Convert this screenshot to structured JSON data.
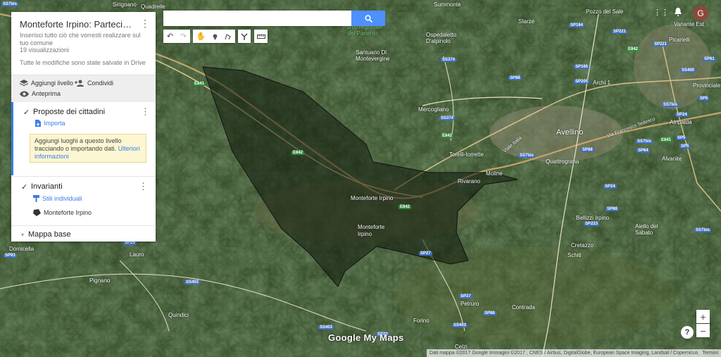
{
  "map_title": "Monteforte Irpino: Partecipa al P...",
  "description": "Inserisci tutto ciò che vorresti realizzare sul tuo comune",
  "views": "19 visualizzazioni",
  "saved_status": "Tutte le modifiche sono state salvate in Drive",
  "actions": {
    "add_layer": "Aggiungi livello",
    "share": "Condividi",
    "preview": "Anteprima"
  },
  "layers": [
    {
      "name": "Proposte dei cittadini",
      "import": "Importa",
      "hint": "Aggiungi luoghi a questo livello tracciando o importando dati.",
      "hint_link": "Ulteriori informazioni"
    },
    {
      "name": "Invarianti",
      "style": "Stili individuali",
      "place": "Monteforte Irpino"
    }
  ],
  "basemap": "Mappa base",
  "search": {
    "placeholder": ""
  },
  "brand": "Google My Maps",
  "attribution": "Dati mappa ©2017 Google Immagini ©2017 , CNES / Airbus, DigitalGlobe, European Space Imaging, Landsat / Copernicus",
  "terms": "Termini",
  "user_initial": "G",
  "map_labels": [
    {
      "text": "Avellino",
      "cls": "city"
    },
    {
      "text": "Monteforte Irpino",
      "cls": "town"
    },
    {
      "text": "Monteforte\nIrpino",
      "cls": "town2"
    },
    {
      "text": "Parco regionale del Partenio",
      "cls": "park"
    },
    {
      "text": "Santuario Di Montevergine",
      "cls": "sanct"
    },
    {
      "text": "Ospedaletto D'alpinolo",
      "cls": "osp"
    },
    {
      "text": "Summonte",
      "cls": "summ"
    },
    {
      "text": "Pozzo del Sale",
      "cls": "pozzo"
    },
    {
      "text": "Starze",
      "cls": "starze"
    },
    {
      "text": "Mercogliano",
      "cls": "merc"
    },
    {
      "text": "Torelli-torrette",
      "cls": "torelli"
    },
    {
      "text": "Moline",
      "cls": "moline"
    },
    {
      "text": "Rivarano",
      "cls": "rivarano"
    },
    {
      "text": "Quattrograna",
      "cls": "quattro"
    },
    {
      "text": "Atripalda",
      "cls": "atri"
    },
    {
      "text": "Alvanite",
      "cls": "alva"
    },
    {
      "text": "Bellizzi Irpino",
      "cls": "belli"
    },
    {
      "text": "Aiello del Sabato",
      "cls": "aiello"
    },
    {
      "text": "Cretazzo",
      "cls": "creta"
    },
    {
      "text": "Schiti",
      "cls": "schiti"
    },
    {
      "text": "Contrada",
      "cls": "contrada"
    },
    {
      "text": "Forino",
      "cls": "forino"
    },
    {
      "text": "Petruro",
      "cls": "petruro"
    },
    {
      "text": "Quindici",
      "cls": "quindici"
    },
    {
      "text": "Pignano",
      "cls": "pignano"
    },
    {
      "text": "Lauro",
      "cls": "lauro"
    },
    {
      "text": "Domicella",
      "cls": "domi"
    },
    {
      "text": "Sirignano",
      "cls": "siri"
    },
    {
      "text": "Quadrelle",
      "cls": "quad"
    },
    {
      "text": "Picarielli",
      "cls": "pica"
    },
    {
      "text": "Variante Est",
      "cls": "variante"
    },
    {
      "text": "Provinciale",
      "cls": "prov"
    },
    {
      "text": "Archi 1",
      "cls": "archi"
    },
    {
      "text": "Celzi",
      "cls": "celzi"
    },
    {
      "text": "Via Francesco Tedesco",
      "cls": "viafr"
    },
    {
      "text": "Viale Italia",
      "cls": "viale"
    }
  ],
  "road_labels": [
    "SS7bis",
    "SP164",
    "SP221",
    "E842",
    "SS374",
    "SP88",
    "SP165",
    "SP205",
    "SP221",
    "SS400",
    "SP61",
    "SP5",
    "SS7bis",
    "SP24",
    "SP5",
    "E841",
    "SS7bis",
    "E842",
    "E842",
    "SS374",
    "SP88",
    "SS7bis",
    "SP24",
    "SP64",
    "SP88",
    "SP223",
    "SS7bis",
    "E842",
    "SP27",
    "SP25",
    "SS403",
    "SP27",
    "SP88",
    "SS403",
    "SS403",
    "SP20",
    "SP93",
    "E841",
    "SP5"
  ]
}
